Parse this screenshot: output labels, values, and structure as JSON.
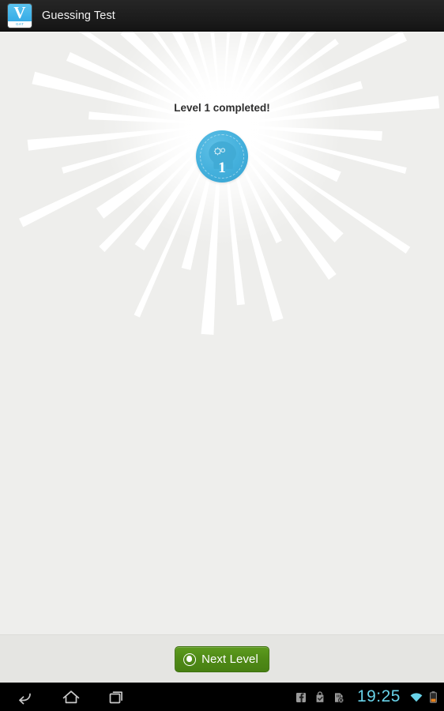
{
  "window": {
    "title": "Guessing Test",
    "app_icon": {
      "name": "app-icon-v",
      "glyph": "V",
      "sublabel": "GAT"
    }
  },
  "main": {
    "level_message": "Level 1 completed!",
    "badge": {
      "name": "level-1-achievement-badge",
      "number": "1",
      "color": "#45b1dd"
    },
    "background_color": "#eeeeec",
    "starburst": {
      "name": "starburst-rays",
      "ray_count": 36,
      "color": "#ffffff"
    }
  },
  "bottom_bar": {
    "next_level_label": "Next Level",
    "button_color": "#4f8a16"
  },
  "navbar": {
    "back_label": "Back",
    "home_label": "Home",
    "recents_label": "Recent apps"
  },
  "statusbar": {
    "time": "19:25",
    "time_color": "#68d2e8",
    "icons": [
      {
        "name": "facebook-notification-icon",
        "glyph": "f"
      },
      {
        "name": "play-store-update-icon",
        "glyph": "bag-check"
      },
      {
        "name": "sim-card-error-icon",
        "glyph": "sim-x"
      },
      {
        "name": "wifi-icon",
        "glyph": "wifi"
      },
      {
        "name": "battery-low-icon",
        "glyph": "battery"
      }
    ]
  }
}
